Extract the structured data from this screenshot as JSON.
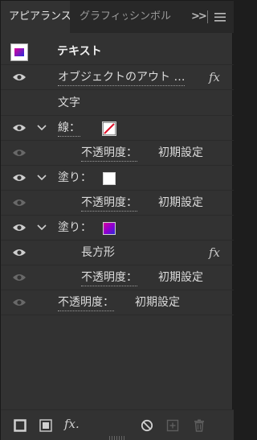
{
  "tabs": [
    {
      "label": "アピアランス",
      "active": true
    },
    {
      "label": "グラフィック",
      "active": false
    },
    {
      "label": "シンボル",
      "active": false
    }
  ],
  "tabbar": {
    "overflow_label": ">>",
    "menu_icon": "hamburger-menu-icon"
  },
  "header": {
    "title": "テキスト"
  },
  "rows": {
    "object_contents": "オブジェクトのアウト …",
    "characters": "文字",
    "stroke_label": "線：",
    "stroke_opacity_label": "不透明度：",
    "stroke_opacity_value": "初期設定",
    "fill1_label": "塗り：",
    "fill1_opacity_label": "不透明度：",
    "fill1_opacity_value": "初期設定",
    "fill2_label": "塗り：",
    "fill2_effect": "長方形",
    "fill2_opacity_label": "不透明度：",
    "fill2_opacity_value": "初期設定",
    "object_opacity_label": "不透明度：",
    "object_opacity_value": "初期設定"
  },
  "fx_label": "fx",
  "colors": {
    "fill1": "#ffffff",
    "fill2_gradient": [
      "#d400a0",
      "#8a00d0",
      "#2a2bd8"
    ],
    "stroke_slash": "#e0102a",
    "thumb": [
      "#e0009c",
      "#2a2bd8"
    ]
  },
  "bottom_icons": [
    "add-new-stroke-icon",
    "add-new-fill-icon",
    "add-new-effect-icon",
    "clear-appearance-icon",
    "duplicate-item-icon",
    "delete-item-icon"
  ],
  "bottom": {
    "fx_label": "fx."
  }
}
